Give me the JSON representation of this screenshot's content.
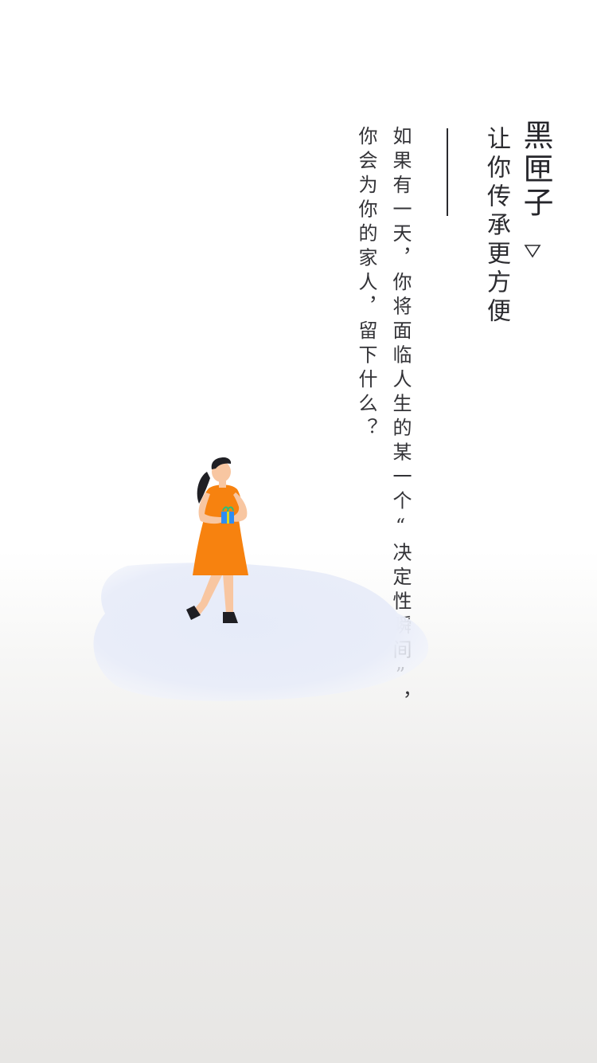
{
  "brand": {
    "title": "黑匣子",
    "icon": "triangle-down-icon"
  },
  "slogan": "让你传承更方便",
  "intro": {
    "line1": "如果有一天，你将面临人生的某一个“决定性瞬间”，",
    "line2": "你会为你的家人，留下什么？"
  },
  "illustration": {
    "subject": "woman-holding-gift",
    "colors": {
      "dress": "#f7820f",
      "skin": "#f8c6a1",
      "hair": "#1f1f24",
      "ground": "#e2e8f8",
      "gift": "#2f8cf2",
      "ribbon": "#e0d61f"
    }
  }
}
